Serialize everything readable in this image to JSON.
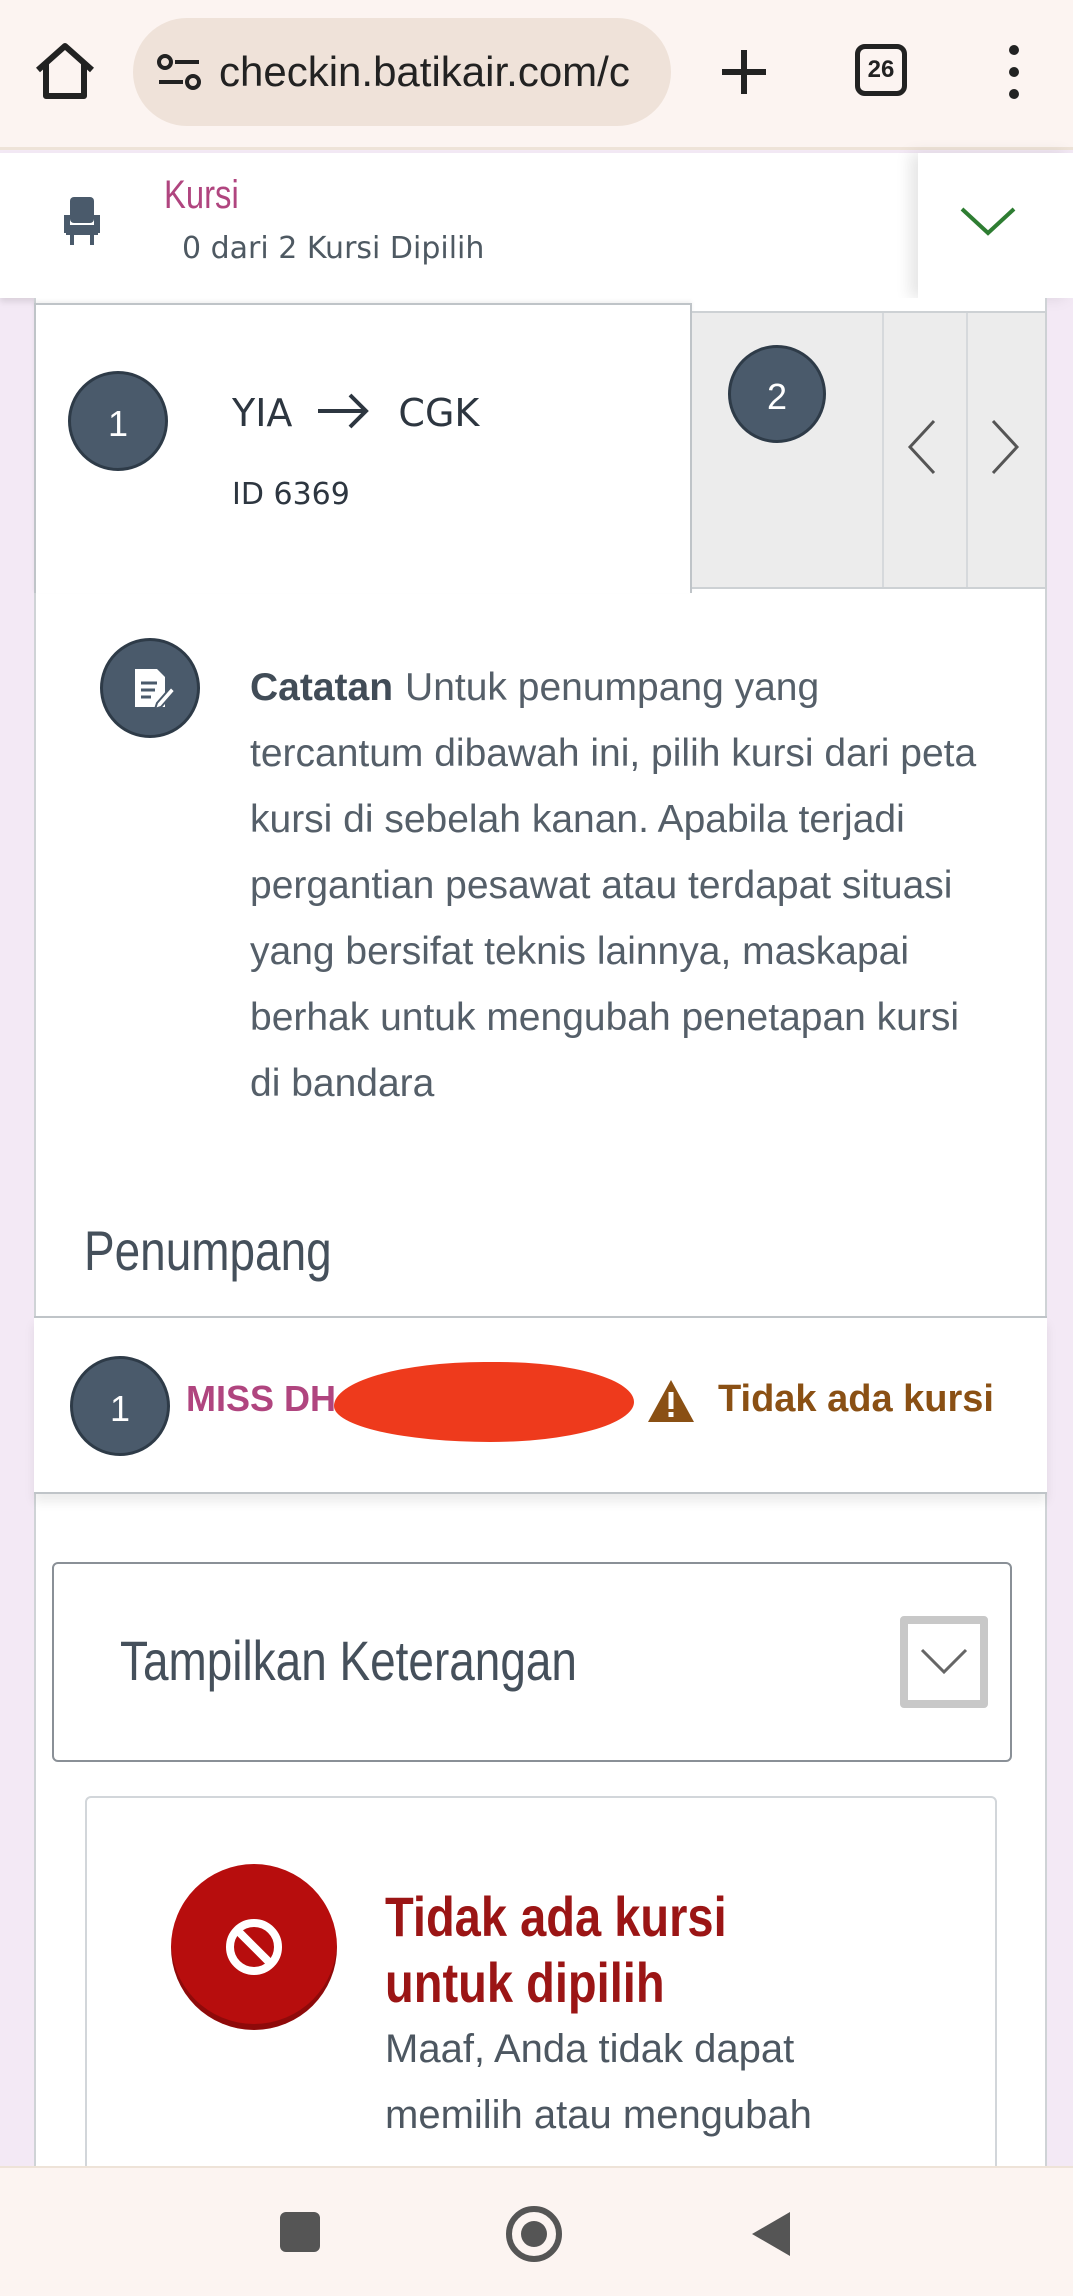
{
  "browser": {
    "url": "checkin.batikair.com/c",
    "tab_count": "26"
  },
  "seat_header": {
    "title": "Kursi",
    "subtitle": "0 dari 2 Kursi Dipilih"
  },
  "flight_tabs": [
    {
      "number": "1",
      "from": "YIA",
      "to": "CGK",
      "flight_no": "ID 6369",
      "active": true
    },
    {
      "number": "2",
      "active": false
    }
  ],
  "note": {
    "label": "Catatan",
    "text": "Untuk penumpang yang tercantum dibawah ini, pilih kursi dari peta kursi di sebelah kanan. Apabila terjadi pergantian pesawat atau terdapat situasi yang bersifat teknis lainnya, maskapai berhak untuk mengubah penetapan kursi di bandara"
  },
  "passengers": {
    "title": "Penumpang",
    "items": [
      {
        "number": "1",
        "name": "MISS DH",
        "status": "Tidak ada kursi"
      }
    ]
  },
  "legend": {
    "label": "Tampilkan Keterangan"
  },
  "no_seat": {
    "title": "Tidak ada kursi untuk dipilih",
    "description": "Maaf, Anda tidak dapat memilih atau mengubah"
  },
  "colors": {
    "accent_magenta": "#b0457f",
    "dark_slate": "#4a5a6b",
    "warning_brown": "#8a5014",
    "error_red": "#b70d0d",
    "redaction": "#ee3a1c"
  }
}
